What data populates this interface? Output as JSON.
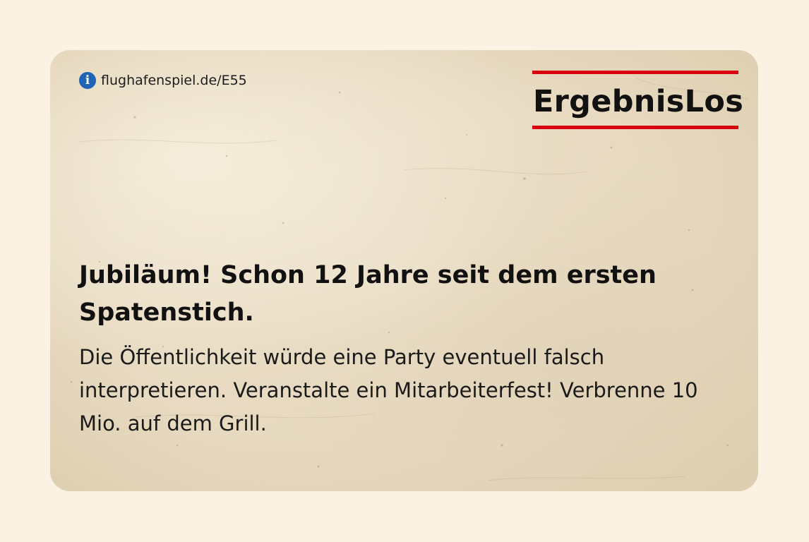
{
  "card": {
    "info_link": "flughafenspiel.de/E55",
    "info_icon": "info-icon",
    "info_glyph": "i",
    "logo_text": "ErgebnisLos",
    "headline": "Jubiläum! Schon 12 Jahre seit dem ersten Spatenstich.",
    "body": "Die Öffentlichkeit würde eine Party eventuell falsch interpretieren. Veranstalte ein Mitarbeiterfest! Verbrenne 10 Mio. auf dem Grill.",
    "colors": {
      "page_background": "#fbf2e4",
      "card_paper": "#e8dbc2",
      "logo_red": "#d9000f",
      "info_blue": "#1f63b4",
      "text": "#111111"
    }
  }
}
